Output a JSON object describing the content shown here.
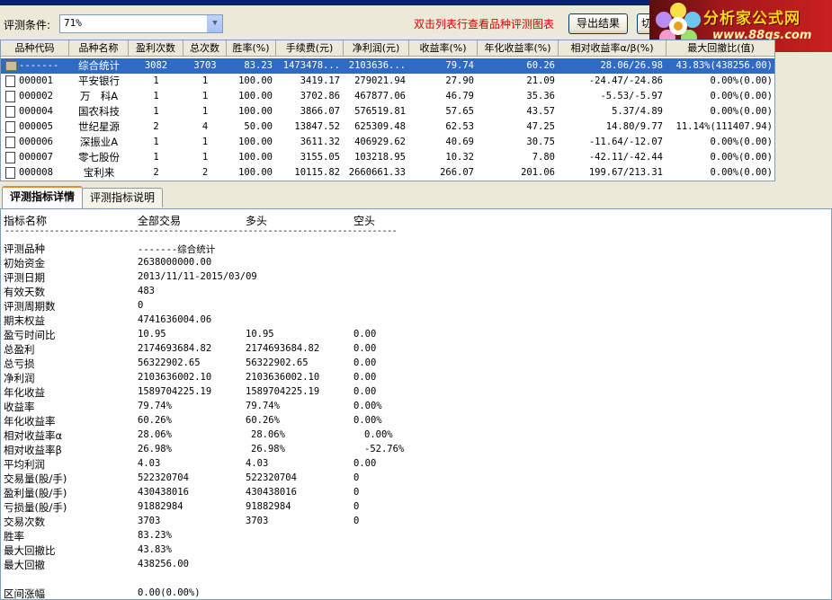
{
  "toolbar": {
    "condition_label": "评测条件:",
    "condition_value": "71%",
    "hint": "双击列表行查看品种评测图表",
    "export_label": "导出结果",
    "other_label": "切"
  },
  "logo": {
    "brand": "分析家公式网",
    "url": "www.88gs.com"
  },
  "grid": {
    "columns": [
      "品种代码",
      "品种名称",
      "盈利次数",
      "总次数",
      "胜率(%)",
      "手续费(元)",
      "净利润(元)",
      "收益率(%)",
      "年化收益率(%)",
      "相对收益率α/β(%)",
      "最大回撤比(值)"
    ],
    "rows": [
      {
        "code": "-------",
        "name": "综合统计",
        "wins": "3082",
        "total": "3703",
        "winrate": "83.23",
        "fee": "1473478...",
        "profit": "2103636...",
        "yield": "79.74",
        "annual": "60.26",
        "relative": "28.06/26.98",
        "drawdown": "43.83%(438256.00)"
      },
      {
        "code": "000001",
        "name": "平安银行",
        "wins": "1",
        "total": "1",
        "winrate": "100.00",
        "fee": "3419.17",
        "profit": "279021.94",
        "yield": "27.90",
        "annual": "21.09",
        "relative": "-24.47/-24.86",
        "drawdown": "0.00%(0.00)"
      },
      {
        "code": "000002",
        "name": "万　科A",
        "wins": "1",
        "total": "1",
        "winrate": "100.00",
        "fee": "3702.86",
        "profit": "467877.06",
        "yield": "46.79",
        "annual": "35.36",
        "relative": "-5.53/-5.97",
        "drawdown": "0.00%(0.00)"
      },
      {
        "code": "000004",
        "name": "国农科技",
        "wins": "1",
        "total": "1",
        "winrate": "100.00",
        "fee": "3866.07",
        "profit": "576519.81",
        "yield": "57.65",
        "annual": "43.57",
        "relative": "5.37/4.89",
        "drawdown": "0.00%(0.00)"
      },
      {
        "code": "000005",
        "name": "世纪星源",
        "wins": "2",
        "total": "4",
        "winrate": "50.00",
        "fee": "13847.52",
        "profit": "625309.48",
        "yield": "62.53",
        "annual": "47.25",
        "relative": "14.80/9.77",
        "drawdown": "11.14%(111407.94)"
      },
      {
        "code": "000006",
        "name": "深振业A",
        "wins": "1",
        "total": "1",
        "winrate": "100.00",
        "fee": "3611.32",
        "profit": "406929.62",
        "yield": "40.69",
        "annual": "30.75",
        "relative": "-11.64/-12.07",
        "drawdown": "0.00%(0.00)"
      },
      {
        "code": "000007",
        "name": "零七股份",
        "wins": "1",
        "total": "1",
        "winrate": "100.00",
        "fee": "3155.05",
        "profit": "103218.95",
        "yield": "10.32",
        "annual": "7.80",
        "relative": "-42.11/-42.44",
        "drawdown": "0.00%(0.00)"
      },
      {
        "code": "000008",
        "name": "宝利来",
        "wins": "2",
        "total": "2",
        "winrate": "100.00",
        "fee": "10115.82",
        "profit": "2660661.33",
        "yield": "266.07",
        "annual": "201.06",
        "relative": "199.67/213.31",
        "drawdown": "0.00%(0.00)"
      }
    ]
  },
  "tabs": [
    "评测指标详情",
    "评测指标说明"
  ],
  "detail": {
    "headers": [
      "指标名称",
      "全部交易",
      "多头",
      "空头"
    ],
    "separator": "--------------------------------------------------------------------------------------------",
    "rows": [
      {
        "label": "评测品种",
        "all": "-------综合统计",
        "long": "",
        "short": ""
      },
      {
        "label": "初始资金",
        "all": "2638000000.00",
        "long": "",
        "short": ""
      },
      {
        "label": "评测日期",
        "all": "2013/11/11-2015/03/09",
        "long": "",
        "short": ""
      },
      {
        "label": "有效天数",
        "all": "483",
        "long": "",
        "short": ""
      },
      {
        "label": "评测周期数",
        "all": "0",
        "long": "",
        "short": ""
      },
      {
        "label": "期末权益",
        "all": "4741636004.06",
        "long": "",
        "short": ""
      },
      {
        "label": "盈亏时间比",
        "all": "10.95",
        "long": "10.95",
        "short": "0.00"
      },
      {
        "label": "总盈利",
        "all": "2174693684.82",
        "long": "2174693684.82",
        "short": "0.00"
      },
      {
        "label": "总亏损",
        "all": "56322902.65",
        "long": "56322902.65",
        "short": "0.00"
      },
      {
        "label": "净利润",
        "all": "2103636002.10",
        "long": "2103636002.10",
        "short": "0.00"
      },
      {
        "label": "年化收益",
        "all": "1589704225.19",
        "long": "1589704225.19",
        "short": "0.00"
      },
      {
        "label": "收益率",
        "all": "79.74%",
        "long": "79.74%",
        "short": "0.00%"
      },
      {
        "label": "年化收益率",
        "all": "60.26%",
        "long": "60.26%",
        "short": "0.00%"
      },
      {
        "label": "相对收益率α",
        "all": "28.06%",
        "long": "28.06%",
        "short": "0.00%"
      },
      {
        "label": "相对收益率β",
        "all": "26.98%",
        "long": "26.98%",
        "short": "-52.76%"
      },
      {
        "label": "平均利润",
        "all": "4.03",
        "long": "4.03",
        "short": "0.00"
      },
      {
        "label": "交易量(股/手)",
        "all": "522320704",
        "long": "522320704",
        "short": "0"
      },
      {
        "label": "盈利量(股/手)",
        "all": "430438016",
        "long": "430438016",
        "short": "0"
      },
      {
        "label": "亏损量(股/手)",
        "all": "91882984",
        "long": "91882984",
        "short": "0"
      },
      {
        "label": "交易次数",
        "all": "3703",
        "long": "3703",
        "short": "0"
      },
      {
        "label": "胜率",
        "all": "83.23%",
        "long": "",
        "short": ""
      },
      {
        "label": "最大回撤比",
        "all": "43.83%",
        "long": "",
        "short": ""
      },
      {
        "label": "最大回撤",
        "all": "438256.00",
        "long": "",
        "short": ""
      },
      {
        "label": "",
        "all": "",
        "long": "",
        "short": ""
      },
      {
        "label": "区间涨幅",
        "all": "0.00(0.00%)",
        "long": "",
        "short": ""
      }
    ]
  }
}
